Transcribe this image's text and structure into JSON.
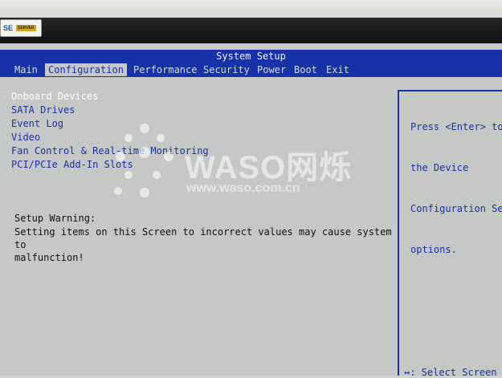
{
  "oem": {
    "label": "SE",
    "tag": "SERVER"
  },
  "title": "System Setup",
  "menu": [
    {
      "label": "Main"
    },
    {
      "label": "Configuration",
      "active": true
    },
    {
      "label": "Performance"
    },
    {
      "label": "Security"
    },
    {
      "label": "Power"
    },
    {
      "label": "Boot"
    },
    {
      "label": "Exit"
    }
  ],
  "items": [
    {
      "label": "Onboard Devices",
      "selected": true
    },
    {
      "label": "SATA Drives"
    },
    {
      "label": "Event Log"
    },
    {
      "label": "Video"
    },
    {
      "label": "Fan Control & Real-time Monitoring"
    },
    {
      "label": "PCI/PCIe Add-In Slots"
    }
  ],
  "warning": {
    "title": "Setup Warning:",
    "line1": "Setting items on this Screen to incorrect values may cause system to",
    "line2": "malfunction!"
  },
  "help": {
    "line1": "Press <Enter> to",
    "line2": "the Device",
    "line3": "Configuration Set",
    "line4": "options."
  },
  "footer": {
    "select_screen": "↔: Select Screen"
  },
  "watermark": {
    "brand": "WASO网烁",
    "url": "www.waso.com.cn"
  },
  "colors": {
    "bios_blue": "#1632a8",
    "screen_gray": "#c6c8c6",
    "highlight": "#ffffff"
  }
}
